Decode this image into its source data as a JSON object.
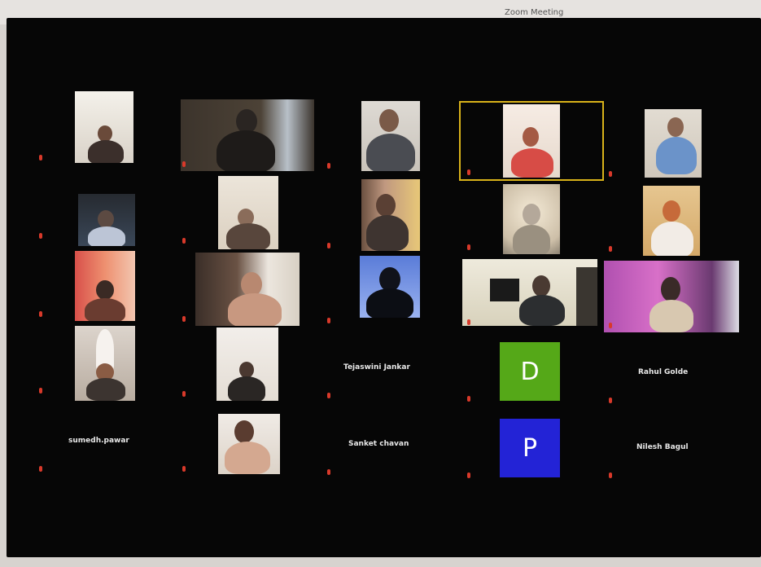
{
  "window": {
    "title": "Zoom Meeting"
  },
  "colors": {
    "active_speaker": "#d8b21a",
    "mic_muted": "#d8392a",
    "avatar_d": "#55a818",
    "avatar_p": "#2323d6"
  },
  "participants": [
    {
      "name": "",
      "kind": "video"
    },
    {
      "name": "",
      "kind": "video"
    },
    {
      "name": "",
      "kind": "video"
    },
    {
      "name": "",
      "kind": "video",
      "active_speaker": true
    },
    {
      "name": "",
      "kind": "video"
    },
    {
      "name": "",
      "kind": "video"
    },
    {
      "name": "",
      "kind": "video"
    },
    {
      "name": "",
      "kind": "video"
    },
    {
      "name": "",
      "kind": "video"
    },
    {
      "name": "",
      "kind": "video"
    },
    {
      "name": "",
      "kind": "video"
    },
    {
      "name": "",
      "kind": "video"
    },
    {
      "name": "",
      "kind": "video"
    },
    {
      "name": "",
      "kind": "video"
    },
    {
      "name": "",
      "kind": "video"
    },
    {
      "name": "",
      "kind": "video"
    },
    {
      "name": "",
      "kind": "video"
    },
    {
      "name": "Tejaswini Jankar",
      "kind": "name-only"
    },
    {
      "name": "",
      "kind": "avatar",
      "initial": "D",
      "icon": "letter-avatar"
    },
    {
      "name": "Rahul Golde",
      "kind": "name-only"
    },
    {
      "name": "sumedh.pawar",
      "kind": "name-only"
    },
    {
      "name": "",
      "kind": "video"
    },
    {
      "name": "Sanket chavan",
      "kind": "name-only"
    },
    {
      "name": "",
      "kind": "avatar",
      "initial": "P",
      "icon": "letter-avatar"
    },
    {
      "name": "Nilesh Bagul",
      "kind": "name-only"
    }
  ]
}
